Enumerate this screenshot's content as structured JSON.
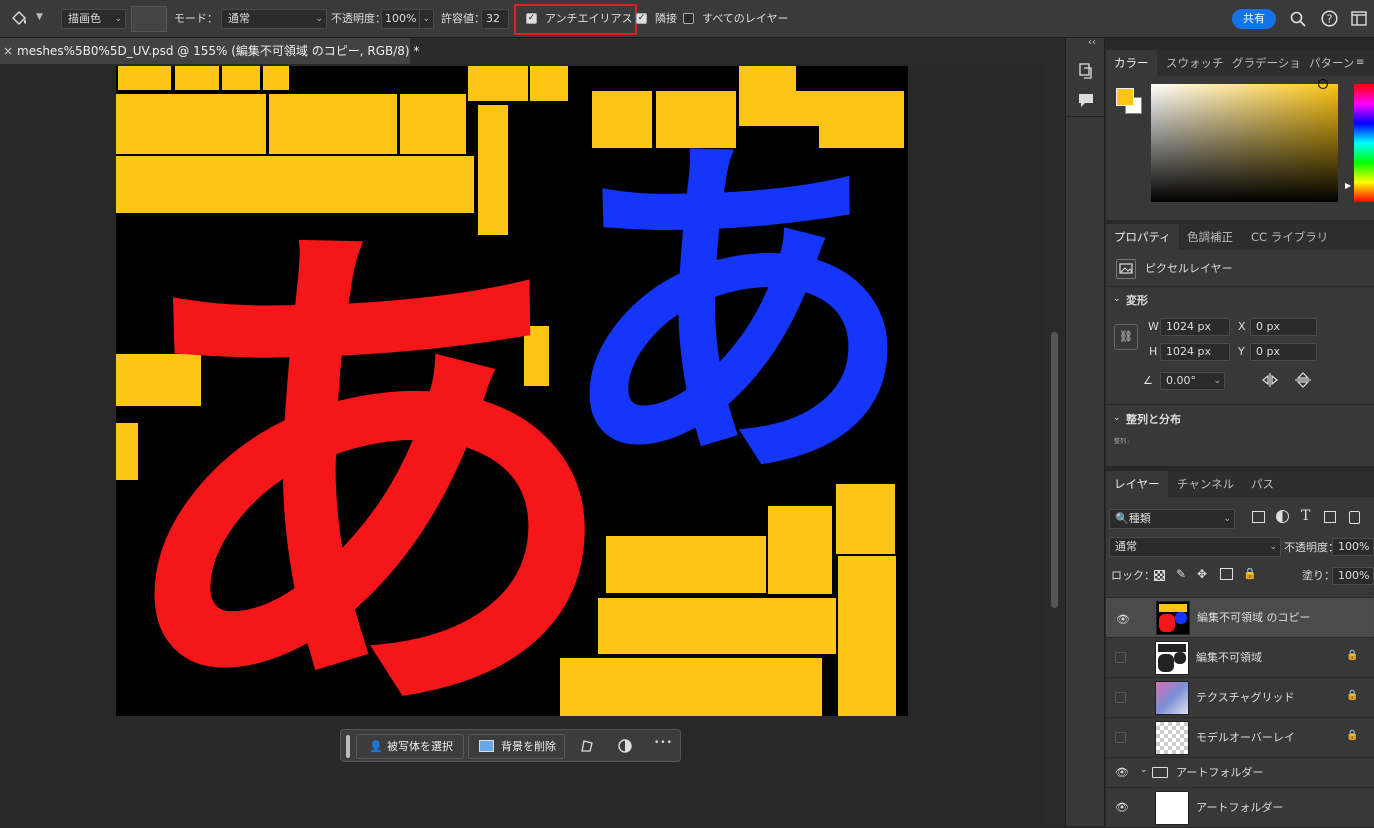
{
  "options_bar": {
    "fill_source": "描画色",
    "mode_label": "モード：",
    "mode_value": "通常",
    "opacity_label": "不透明度：",
    "opacity_value": "100%",
    "tolerance_label": "許容値：",
    "tolerance_value": "32",
    "antialias_label": "アンチエイリアス",
    "antialias_checked": true,
    "contiguous_label": "隣接",
    "contiguous_checked": true,
    "all_layers_label": "すべてのレイヤー",
    "all_layers_checked": false,
    "share_label": "共有",
    "highlight_color": "#e01f1f"
  },
  "document": {
    "tab_title": "meshes%5B0%5D_UV.psd @ 155% (編集不可領域 のコピー, RGB/8) *",
    "close_glyph": "×",
    "glyph_red": "あ",
    "glyph_blue": "あ",
    "colors": {
      "yellow": "#fdc515",
      "red": "#f5161a",
      "blue": "#1635fa",
      "background": "#000000"
    }
  },
  "context_bar": {
    "select_subject": "被写体を選択",
    "remove_background": "背景を削除",
    "more": "•••"
  },
  "collapse_glyph": "‹‹",
  "color_panel": {
    "tabs": [
      "カラー",
      "スウォッチ",
      "グラデーショ",
      "パターン"
    ],
    "foreground": "#fdc515",
    "background": "#ffffff"
  },
  "properties_panel": {
    "tabs": [
      "プロパティ",
      "色調補正",
      "CC ライブラリ"
    ],
    "layer_type": "ピクセルレイヤー",
    "transform_title": "変形",
    "w_label": "W",
    "w_value": "1024 px",
    "h_label": "H",
    "h_value": "1024 px",
    "x_label": "X",
    "x_value": "0 px",
    "y_label": "Y",
    "y_value": "0 px",
    "angle_value": "0.00°",
    "align_title": "整列と分布",
    "align_sub": "整列 :"
  },
  "layers_panel": {
    "tabs": [
      "レイヤー",
      "チャンネル",
      "パス"
    ],
    "filter_label": "種類",
    "blend_mode": "通常",
    "opacity_label": "不透明度：",
    "opacity_value": "100%",
    "lock_label": "ロック：",
    "fill_label": "塗り：",
    "fill_value": "100%",
    "layers": [
      {
        "name": "編集不可領域 のコピー",
        "visible": true,
        "locked": false,
        "selected": true
      },
      {
        "name": "編集不可領域",
        "visible": false,
        "locked": true,
        "selected": false
      },
      {
        "name": "テクスチャグリッド",
        "visible": false,
        "locked": true,
        "selected": false
      },
      {
        "name": "モデルオーバーレイ",
        "visible": false,
        "locked": true,
        "selected": false
      },
      {
        "name": "アートフォルダー",
        "visible": true,
        "locked": false,
        "selected": false,
        "group": true
      },
      {
        "name": "アートフォルダー",
        "visible": true,
        "locked": false,
        "selected": false
      }
    ]
  }
}
